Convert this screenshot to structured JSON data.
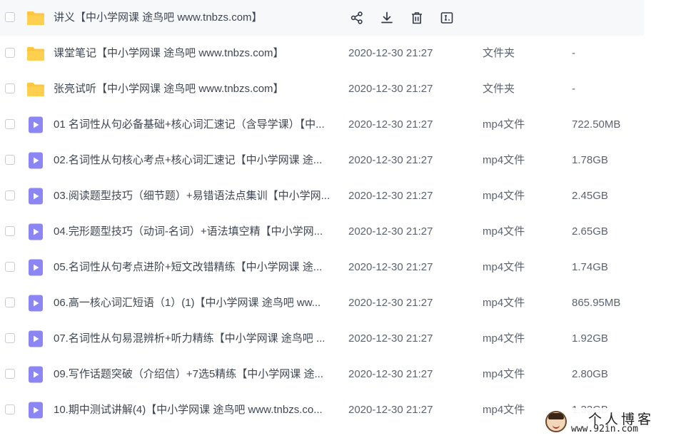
{
  "colors": {
    "folder": "#ffc53d",
    "video_tile": "#8c86f4",
    "text": "#3f4653",
    "muted": "#5c6370",
    "hover_row": "#f7f8fa",
    "checkbox_border": "#c9ccd4"
  },
  "actions": [
    {
      "name": "share-icon",
      "label": "share"
    },
    {
      "name": "download-icon",
      "label": "download"
    },
    {
      "name": "delete-icon",
      "label": "delete"
    },
    {
      "name": "rename-icon",
      "label": "rename"
    }
  ],
  "files": [
    {
      "icon": "folder-icon",
      "name": "讲义【中小学网课 途鸟吧 www.tnbzs.com】",
      "time": "",
      "type": "",
      "size": "",
      "hover": true
    },
    {
      "icon": "folder-icon",
      "name": "课堂笔记【中小学网课 途鸟吧 www.tnbzs.com】",
      "time": "2020-12-30 21:27",
      "type": "文件夹",
      "size": "-"
    },
    {
      "icon": "folder-icon",
      "name": "张亮试听【中小学网课 途鸟吧 www.tnbzs.com】",
      "time": "2020-12-30 21:27",
      "type": "文件夹",
      "size": "-"
    },
    {
      "icon": "video-file-icon",
      "name": "01 名词性从句必备基础+核心词汇速记（含导学课）【中...",
      "time": "2020-12-30 21:27",
      "type": "mp4文件",
      "size": "722.50MB"
    },
    {
      "icon": "video-file-icon",
      "name": "02.名词性从句核心考点+核心词汇速记【中小学网课 途...",
      "time": "2020-12-30 21:27",
      "type": "mp4文件",
      "size": "1.78GB"
    },
    {
      "icon": "video-file-icon",
      "name": "03.阅读题型技巧（细节题）+易错语法点集训【中小学网...",
      "time": "2020-12-30 21:27",
      "type": "mp4文件",
      "size": "2.45GB"
    },
    {
      "icon": "video-file-icon",
      "name": "04.完形题型技巧（动词-名词）+语法填空精【中小学网...",
      "time": "2020-12-30 21:27",
      "type": "mp4文件",
      "size": "2.65GB"
    },
    {
      "icon": "video-file-icon",
      "name": "05.名词性从句考点进阶+短文改错精练【中小学网课 途...",
      "time": "2020-12-30 21:27",
      "type": "mp4文件",
      "size": "1.74GB"
    },
    {
      "icon": "video-file-icon",
      "name": "06.高一核心词汇短语（1）(1)【中小学网课 途鸟吧 ww...",
      "time": "2020-12-30 21:27",
      "type": "mp4文件",
      "size": "865.95MB"
    },
    {
      "icon": "video-file-icon",
      "name": "07.名词性从句易混辨析+听力精练【中小学网课 途鸟吧 ...",
      "time": "2020-12-30 21:27",
      "type": "mp4文件",
      "size": "1.92GB"
    },
    {
      "icon": "video-file-icon",
      "name": "09.写作话题突破（介绍信）+7选5精练【中小学网课 途...",
      "time": "2020-12-30 21:27",
      "type": "mp4文件",
      "size": "2.80GB"
    },
    {
      "icon": "video-file-icon",
      "name": "10.期中测试讲解(4)【中小学网课 途鸟吧 www.tnbzs.co...",
      "time": "2020-12-30 21:27",
      "type": "mp4文件",
      "size": "1.33GB"
    }
  ],
  "watermark": {
    "title": "个人博客",
    "url": "www.92in.com"
  }
}
